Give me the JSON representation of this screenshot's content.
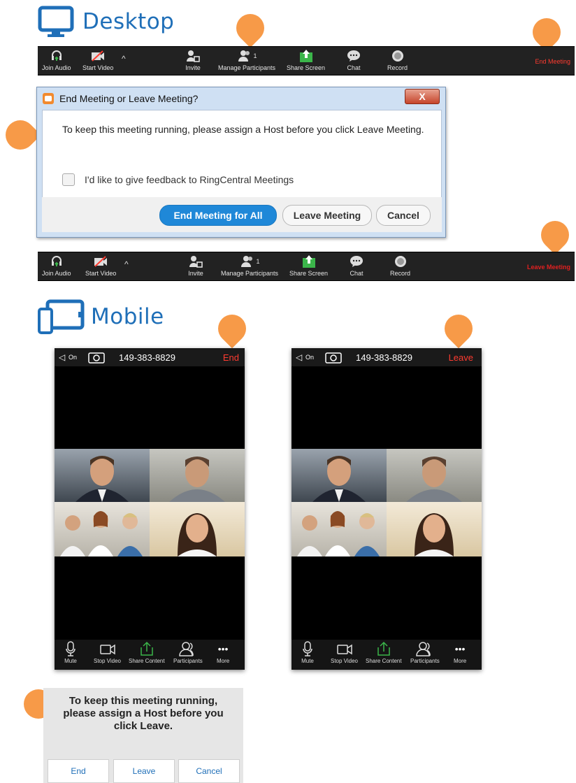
{
  "desktop": {
    "heading": "Desktop",
    "toolbar_items": [
      "Join Audio",
      "Start Video",
      "Invite",
      "Manage Participants",
      "Share Screen",
      "Chat",
      "Record"
    ],
    "participant_count": "1",
    "end_meeting_label": "End Meeting",
    "leave_meeting_label": "Leave Meeting"
  },
  "dialog": {
    "title": "End Meeting or Leave Meeting?",
    "close": "X",
    "message": "To keep this meeting running, please assign a Host before you click Leave Meeting.",
    "checkbox_label": "I'd like to give feedback to RingCentral Meetings",
    "end_all": "End Meeting for All",
    "leave": "Leave Meeting",
    "cancel": "Cancel"
  },
  "mobile": {
    "heading": "Mobile",
    "speaker_on": "On",
    "meeting_id": "149-383-8829",
    "end_label": "End",
    "leave_label": "Leave",
    "bottom_items": [
      "Mute",
      "Stop Video",
      "Share Content",
      "Participants",
      "More"
    ],
    "more_dots": "•••"
  },
  "alert": {
    "message": "To keep this meeting running, please assign a Host before you click Leave.",
    "end": "End",
    "leave": "Leave",
    "cancel": "Cancel"
  },
  "colors": {
    "accent_blue": "#1f6fb8",
    "pin_orange": "#f79a48",
    "end_red": "#ff3b30",
    "share_green": "#3bb54a"
  }
}
